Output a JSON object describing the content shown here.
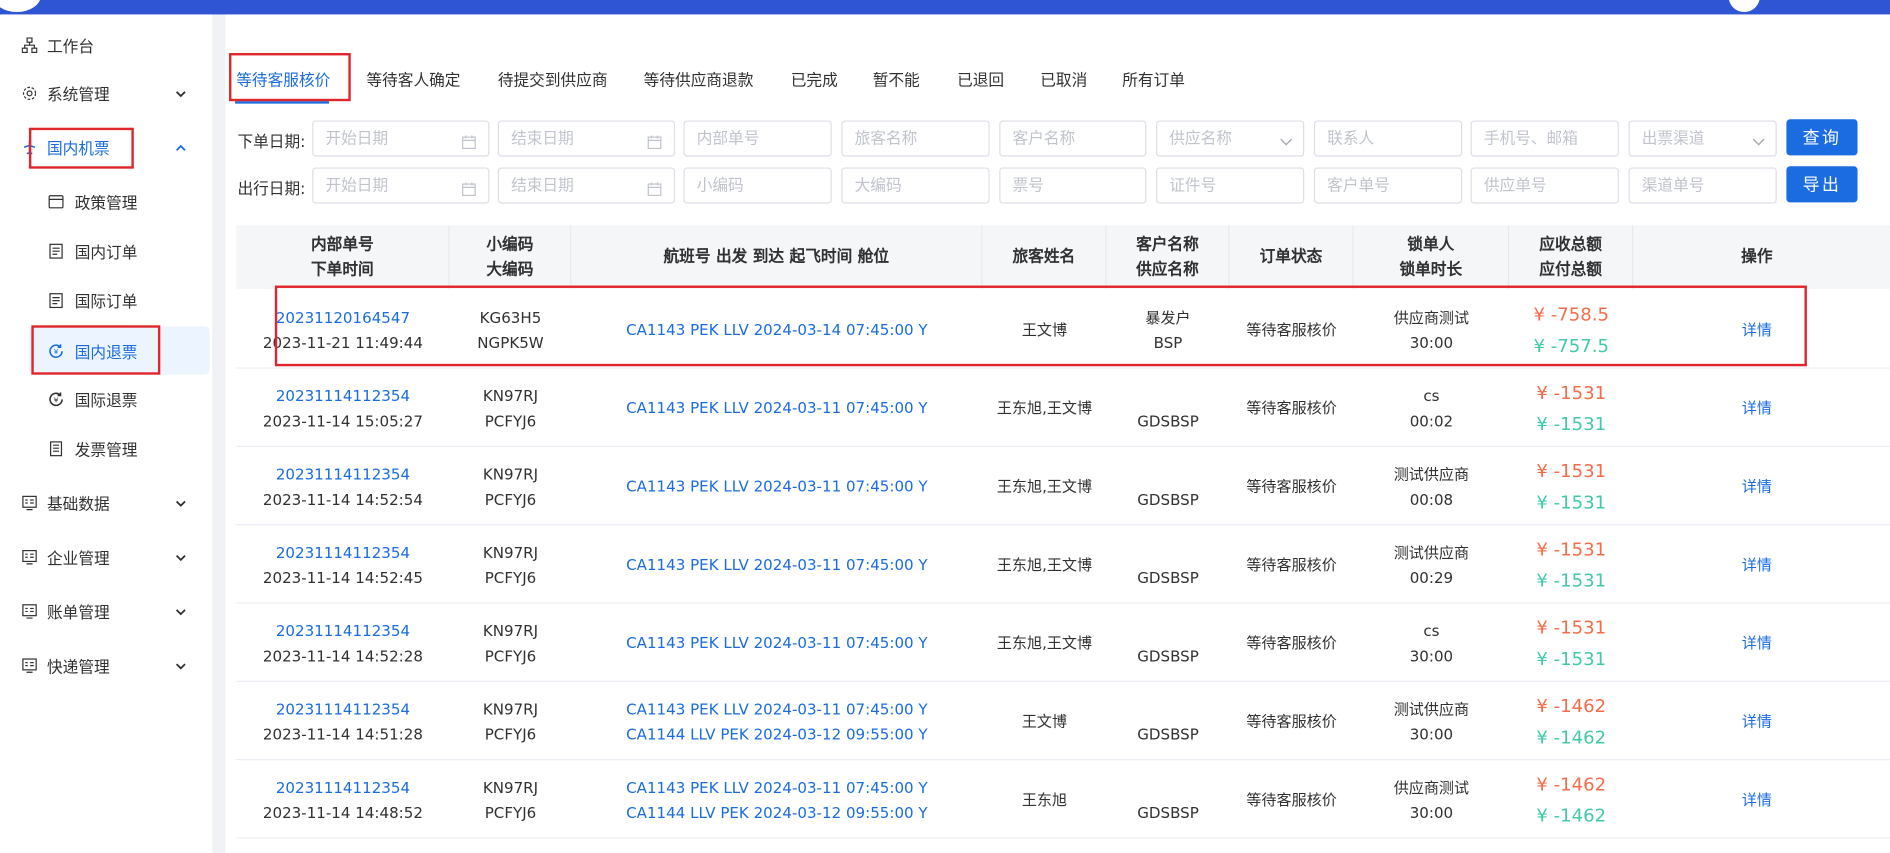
{
  "sidebar": {
    "items": [
      {
        "label": "工作台",
        "icon": "sitemap-icon"
      },
      {
        "label": "系统管理",
        "icon": "gear-icon"
      },
      {
        "label": "国内机票",
        "icon": "plane-icon"
      },
      {
        "label": "政策管理",
        "icon": "window-icon"
      },
      {
        "label": "国内订单",
        "icon": "document-icon"
      },
      {
        "label": "国际订单",
        "icon": "document-icon"
      },
      {
        "label": "国内退票",
        "icon": "refund-icon"
      },
      {
        "label": "国际退票",
        "icon": "refund-icon"
      },
      {
        "label": "发票管理",
        "icon": "invoice-icon"
      },
      {
        "label": "基础数据",
        "icon": "data-icon"
      },
      {
        "label": "企业管理",
        "icon": "company-icon"
      },
      {
        "label": "账单管理",
        "icon": "bill-icon"
      },
      {
        "label": "快递管理",
        "icon": "express-icon"
      }
    ]
  },
  "tabs": [
    "等待客服核价",
    "等待客人确定",
    "待提交到供应商",
    "等待供应商退款",
    "已完成",
    "暂不能",
    "已退回",
    "已取消",
    "所有订单"
  ],
  "filters": {
    "order_date_label": "下单日期:",
    "travel_date_label": "出行日期:",
    "start_date": "开始日期",
    "end_date": "结束日期",
    "internal_no": "内部单号",
    "passenger_name": "旅客名称",
    "customer_name": "客户名称",
    "supplier_name": "供应名称",
    "contact": "联系人",
    "phone_email": "手机号、邮箱",
    "ticket_channel": "出票渠道",
    "small_code": "小编码",
    "big_code": "大编码",
    "ticket_no": "票号",
    "id_no": "证件号",
    "customer_order_no": "客户单号",
    "supplier_order_no": "供应单号",
    "channel_order_no": "渠道单号",
    "query_button": "查询",
    "export_button": "导出"
  },
  "table": {
    "headers": {
      "internal_no": "内部单号",
      "order_time": "下单时间",
      "small_code": "小编码",
      "big_code": "大编码",
      "flight": "航班号 出发 到达 起飞时间 舱位",
      "passenger": "旅客姓名",
      "customer": "客户名称",
      "supplier": "供应名称",
      "status": "订单状态",
      "locker": "锁单人",
      "lock_duration": "锁单时长",
      "receivable": "应收总额",
      "payable": "应付总额",
      "action": "操作"
    },
    "rows": [
      {
        "internal_no": "20231120164547",
        "order_time": "2023-11-21 11:49:44",
        "small_code": "KG63H5",
        "big_code": "NGPK5W",
        "flight1": "CA1143 PEK LLV 2024-03-14 07:45:00 Y",
        "flight2": "",
        "passenger": "王文博",
        "customer": "暴发户",
        "supplier": "BSP",
        "status": "等待客服核价",
        "locker": "供应商测试",
        "lock_duration": "30:00",
        "receivable": "¥ -758.5",
        "payable": "¥ -757.5",
        "action": "详情"
      },
      {
        "internal_no": "20231114112354",
        "order_time": "2023-11-14 15:05:27",
        "small_code": "KN97RJ",
        "big_code": "PCFYJ6",
        "flight1": "CA1143 PEK LLV 2024-03-11 07:45:00 Y",
        "flight2": "",
        "passenger": "王东旭,王文博",
        "customer": "",
        "supplier": "GDSBSP",
        "status": "等待客服核价",
        "locker": "cs",
        "lock_duration": "00:02",
        "receivable": "¥ -1531",
        "payable": "¥ -1531",
        "action": "详情"
      },
      {
        "internal_no": "20231114112354",
        "order_time": "2023-11-14 14:52:54",
        "small_code": "KN97RJ",
        "big_code": "PCFYJ6",
        "flight1": "CA1143 PEK LLV 2024-03-11 07:45:00 Y",
        "flight2": "",
        "passenger": "王东旭,王文博",
        "customer": "",
        "supplier": "GDSBSP",
        "status": "等待客服核价",
        "locker": "测试供应商",
        "lock_duration": "00:08",
        "receivable": "¥ -1531",
        "payable": "¥ -1531",
        "action": "详情"
      },
      {
        "internal_no": "20231114112354",
        "order_time": "2023-11-14 14:52:45",
        "small_code": "KN97RJ",
        "big_code": "PCFYJ6",
        "flight1": "CA1143 PEK LLV 2024-03-11 07:45:00 Y",
        "flight2": "",
        "passenger": "王东旭,王文博",
        "customer": "",
        "supplier": "GDSBSP",
        "status": "等待客服核价",
        "locker": "测试供应商",
        "lock_duration": "00:29",
        "receivable": "¥ -1531",
        "payable": "¥ -1531",
        "action": "详情"
      },
      {
        "internal_no": "20231114112354",
        "order_time": "2023-11-14 14:52:28",
        "small_code": "KN97RJ",
        "big_code": "PCFYJ6",
        "flight1": "CA1143 PEK LLV 2024-03-11 07:45:00 Y",
        "flight2": "",
        "passenger": "王东旭,王文博",
        "customer": "",
        "supplier": "GDSBSP",
        "status": "等待客服核价",
        "locker": "cs",
        "lock_duration": "30:00",
        "receivable": "¥ -1531",
        "payable": "¥ -1531",
        "action": "详情"
      },
      {
        "internal_no": "20231114112354",
        "order_time": "2023-11-14 14:51:28",
        "small_code": "KN97RJ",
        "big_code": "PCFYJ6",
        "flight1": "CA1143 PEK LLV 2024-03-11 07:45:00 Y",
        "flight2": "CA1144 LLV PEK 2024-03-12 09:55:00 Y",
        "passenger": "王文博",
        "customer": "",
        "supplier": "GDSBSP",
        "status": "等待客服核价",
        "locker": "测试供应商",
        "lock_duration": "30:00",
        "receivable": "¥ -1462",
        "payable": "¥ -1462",
        "action": "详情"
      },
      {
        "internal_no": "20231114112354",
        "order_time": "2023-11-14 14:48:52",
        "small_code": "KN97RJ",
        "big_code": "PCFYJ6",
        "flight1": "CA1143 PEK LLV 2024-03-11 07:45:00 Y",
        "flight2": "CA1144 LLV PEK 2024-03-12 09:55:00 Y",
        "passenger": "王东旭",
        "customer": "",
        "supplier": "GDSBSP",
        "status": "等待客服核价",
        "locker": "供应商测试",
        "lock_duration": "30:00",
        "receivable": "¥ -1462",
        "payable": "¥ -1462",
        "action": "详情"
      }
    ]
  },
  "colors": {
    "primary": "#1a6ce0",
    "highlight_box": "#e0262b",
    "receivable": "#f56c4a",
    "payable": "#42c9a8",
    "topbar": "#2f55d4"
  }
}
